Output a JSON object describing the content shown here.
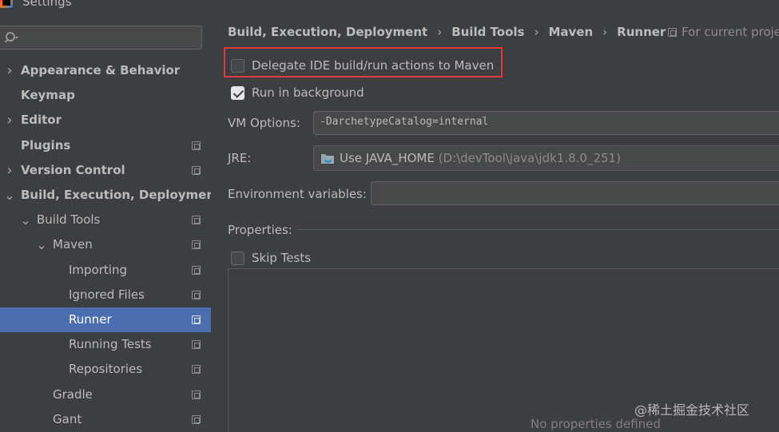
{
  "window": {
    "title": "Settings"
  },
  "search": {
    "placeholder": ""
  },
  "sidebar": {
    "items": [
      {
        "label": "Appearance & Behavior",
        "bold": true,
        "arrow": "right",
        "indent": 0,
        "copy": false
      },
      {
        "label": "Keymap",
        "bold": true,
        "arrow": "",
        "indent": 0,
        "copy": false
      },
      {
        "label": "Editor",
        "bold": true,
        "arrow": "right",
        "indent": 0,
        "copy": false
      },
      {
        "label": "Plugins",
        "bold": true,
        "arrow": "",
        "indent": 0,
        "copy": true
      },
      {
        "label": "Version Control",
        "bold": true,
        "arrow": "right",
        "indent": 0,
        "copy": true
      },
      {
        "label": "Build, Execution, Deployment",
        "bold": true,
        "arrow": "down",
        "indent": 0,
        "copy": false
      },
      {
        "label": "Build Tools",
        "bold": false,
        "arrow": "down",
        "indent": 1,
        "copy": true
      },
      {
        "label": "Maven",
        "bold": false,
        "arrow": "down",
        "indent": 2,
        "copy": true
      },
      {
        "label": "Importing",
        "bold": false,
        "arrow": "",
        "indent": 3,
        "copy": true
      },
      {
        "label": "Ignored Files",
        "bold": false,
        "arrow": "",
        "indent": 3,
        "copy": true
      },
      {
        "label": "Runner",
        "bold": false,
        "arrow": "",
        "indent": 3,
        "copy": true,
        "selected": true
      },
      {
        "label": "Running Tests",
        "bold": false,
        "arrow": "",
        "indent": 3,
        "copy": true
      },
      {
        "label": "Repositories",
        "bold": false,
        "arrow": "",
        "indent": 3,
        "copy": true
      },
      {
        "label": "Gradle",
        "bold": false,
        "arrow": "",
        "indent": 2,
        "copy": true
      },
      {
        "label": "Gant",
        "bold": false,
        "arrow": "",
        "indent": 2,
        "copy": true
      }
    ]
  },
  "breadcrumb": [
    "Build, Execution, Deployment",
    "Build Tools",
    "Maven",
    "Runner"
  ],
  "for_project": "For current proje",
  "options": {
    "delegate": {
      "label": "Delegate IDE build/run actions to Maven",
      "checked": false
    },
    "run_background": {
      "label": "Run in background",
      "checked": true
    },
    "vm_options_label": "VM Options:",
    "vm_options_value": "-DarchetypeCatalog=internal",
    "jre_label": "JRE:",
    "jre_value": "Use JAVA_HOME",
    "jre_path": "(D:\\devTool\\java\\jdk1.8.0_251)",
    "env_label": "Environment variables:",
    "env_value": "",
    "properties_label": "Properties:",
    "skip_tests": {
      "label": "Skip Tests",
      "checked": false
    },
    "no_properties": "No properties defined"
  },
  "watermark": "@稀土掘金技术社区",
  "colors": {
    "accent_selected": "#4b6eaf",
    "highlight_border": "#e0393e"
  }
}
